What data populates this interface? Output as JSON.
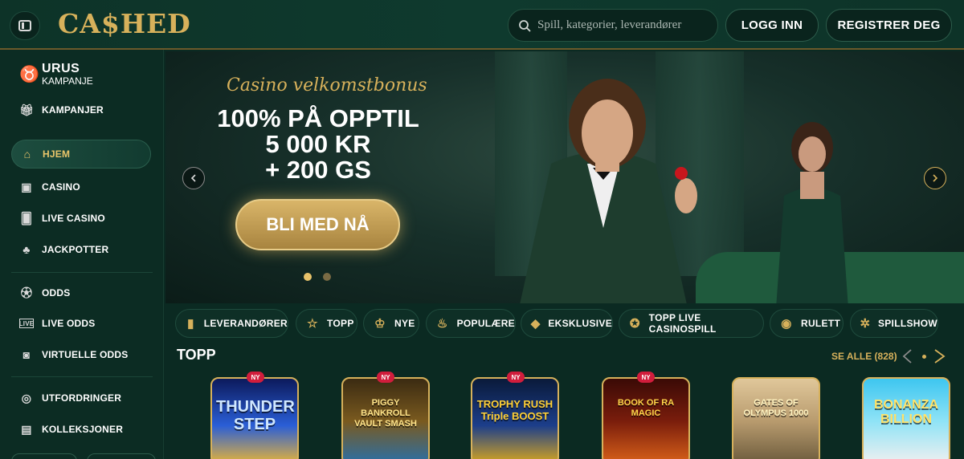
{
  "header": {
    "logo": "CA$HED",
    "search_placeholder": "Spill, kategorier, leverandører",
    "login": "LOGG INN",
    "register": "REGISTRER DEG"
  },
  "sidebar": {
    "promo_title": "URUS",
    "promo_sub": "KAMPANJE",
    "items": [
      {
        "label": "KAMPANJER",
        "icon": "gift-icon"
      },
      {
        "label": "HJEM",
        "icon": "home-icon",
        "active": true
      },
      {
        "label": "CASINO",
        "icon": "slot-icon"
      },
      {
        "label": "LIVE CASINO",
        "icon": "cards-icon"
      },
      {
        "label": "JACKPOTTER",
        "icon": "clover-icon"
      },
      {
        "label": "ODDS",
        "icon": "ball-icon"
      },
      {
        "label": "LIVE ODDS",
        "icon": "live-icon"
      },
      {
        "label": "VIRTUELLE ODDS",
        "icon": "virtual-ball-icon"
      },
      {
        "label": "UTFORDRINGER",
        "icon": "target-icon"
      },
      {
        "label": "KOLLEKSJONER",
        "icon": "album-icon"
      }
    ]
  },
  "banner": {
    "script": "Casino velkomstbonus",
    "line1": "100% PÅ OPPTIL",
    "line2": "5 000 KR",
    "line3": "+ 200 GS",
    "cta": "BLI MED NÅ"
  },
  "chips": [
    {
      "label": "LEVERANDØRER",
      "icon": "book-icon"
    },
    {
      "label": "TOPP",
      "icon": "star-icon"
    },
    {
      "label": "NYE",
      "icon": "crown-icon"
    },
    {
      "label": "POPULÆRE",
      "icon": "flame-icon"
    },
    {
      "label": "EKSKLUSIVE",
      "icon": "diamond-icon"
    },
    {
      "label": "TOPP LIVE CASINOSPILL",
      "icon": "medal-icon"
    },
    {
      "label": "RULETT",
      "icon": "roulette-icon"
    },
    {
      "label": "SPILLSHOW",
      "icon": "wheel-icon"
    }
  ],
  "section": {
    "title": "TOPP",
    "see_all": "SE ALLE (828)"
  },
  "games": [
    {
      "title": "THUNDER STEP",
      "badge": "NY"
    },
    {
      "title": "PIGGY BANKROLL VAULT SMASH",
      "badge": "NY"
    },
    {
      "title": "TROPHY RUSH Triple BOOST",
      "badge": "NY"
    },
    {
      "title": "BOOK OF RA MAGIC",
      "badge": "NY"
    },
    {
      "title": "GATES OF OLYMPUS 1000",
      "badge": ""
    },
    {
      "title": "BONANZA BILLION",
      "badge": ""
    }
  ],
  "colors": {
    "gold": "#d7b15b",
    "bg": "#0b2a22",
    "badge": "#d11d3c"
  }
}
